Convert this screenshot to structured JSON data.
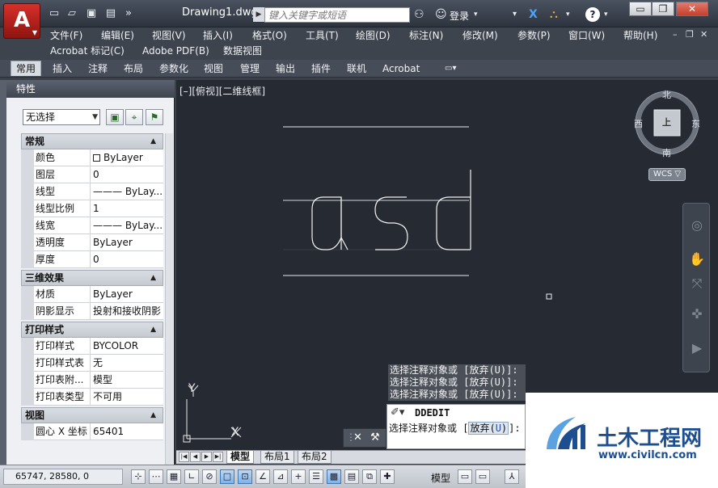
{
  "title_bar": {
    "app_button_letter": "A",
    "document_title": "Drawing1.dwg",
    "search_placeholder": "键入关键字或短语",
    "login_label": "登录",
    "more_arrow": "»",
    "window_minimize": "▭",
    "window_restore": "❐",
    "window_close": "✕",
    "exchange_icon": "X",
    "help_icon": "?"
  },
  "menu_bar": {
    "row1": [
      "文件(F)",
      "编辑(E)",
      "视图(V)",
      "插入(I)",
      "格式(O)",
      "工具(T)",
      "绘图(D)",
      "标注(N)",
      "修改(M)",
      "参数(P)",
      "窗口(W)",
      "帮助(H)"
    ],
    "row2": [
      "Acrobat 标记(C)",
      "Adobe PDF(B)",
      "数据视图"
    ],
    "doc_controls": [
      "–",
      "❐",
      "✕"
    ]
  },
  "ribbon_tabs": {
    "tabs": [
      "常用",
      "插入",
      "注释",
      "布局",
      "参数化",
      "视图",
      "管理",
      "输出",
      "插件",
      "联机",
      "Acrobat"
    ],
    "active_index": 0,
    "extra": "▭▾"
  },
  "properties_palette": {
    "title": "特性",
    "selection": "无选择",
    "sections": [
      {
        "title": "常规",
        "rows": [
          {
            "name": "颜色",
            "value": "ByLayer",
            "swatch": true
          },
          {
            "name": "图层",
            "value": "0"
          },
          {
            "name": "线型",
            "value": "——— ByLay..."
          },
          {
            "name": "线型比例",
            "value": "1"
          },
          {
            "name": "线宽",
            "value": "——— ByLay..."
          },
          {
            "name": "透明度",
            "value": "ByLayer"
          },
          {
            "name": "厚度",
            "value": "0"
          }
        ]
      },
      {
        "title": "三维效果",
        "rows": [
          {
            "name": "材质",
            "value": "ByLayer"
          },
          {
            "name": "阴影显示",
            "value": "投射和接收阴影"
          }
        ]
      },
      {
        "title": "打印样式",
        "rows": [
          {
            "name": "打印样式",
            "value": "BYCOLOR"
          },
          {
            "name": "打印样式表",
            "value": "无"
          },
          {
            "name": "打印表附...",
            "value": "模型"
          },
          {
            "name": "打印表类型",
            "value": "不可用"
          }
        ]
      },
      {
        "title": "视图",
        "rows": [
          {
            "name": "圆心 X 坐标",
            "value": "65401"
          }
        ]
      }
    ]
  },
  "canvas": {
    "view_label": "[–][俯视][二维线框]",
    "drawn_text": "asd",
    "viewcube": {
      "north": "北",
      "south": "南",
      "east": "东",
      "west": "西",
      "center": "上"
    },
    "wcs_label": "WCS ▽",
    "ucs_x": "X",
    "ucs_y": "Y"
  },
  "command": {
    "history": [
      "选择注释对象或 [放弃(U)]:",
      "选择注释对象或 [放弃(U)]:",
      "选择注释对象或 [放弃(U)]:"
    ],
    "current_command": "DDEDIT",
    "prompt_prefix": "选择注释对象或 [",
    "prompt_option_pre": "放弃(",
    "prompt_option_key": "U",
    "prompt_option_post": ")",
    "prompt_suffix": "]:",
    "close_icon": "✕"
  },
  "layout_tabs": {
    "tabs": [
      "模型",
      "布局1",
      "布局2"
    ],
    "active_index": 0,
    "nav": [
      "|◀",
      "◀",
      "▶",
      "▶|"
    ]
  },
  "status_bar": {
    "coordinates": "65747, 28580, 0",
    "model_label": "模型"
  },
  "watermark": {
    "title": "土木工程网",
    "url": "www.civilcn.com"
  },
  "colors": {
    "canvas_bg": "#252a33",
    "app_button": "#c8221c",
    "watermark_blue": "#1d4e8f"
  }
}
